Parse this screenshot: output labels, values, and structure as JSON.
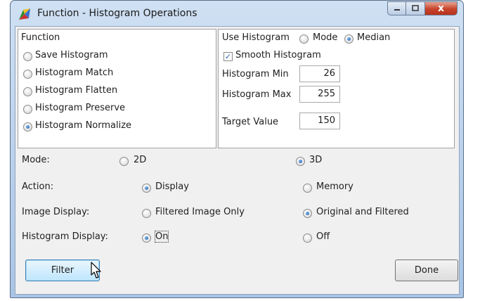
{
  "window": {
    "title": "Function - Histogram Operations",
    "close_glyph": "x"
  },
  "function_group": {
    "title": "Function",
    "options": [
      {
        "label": "Save Histogram",
        "selected": false
      },
      {
        "label": "Histogram Match",
        "selected": false
      },
      {
        "label": "Histogram Flatten",
        "selected": false
      },
      {
        "label": "Histogram Preserve",
        "selected": false
      },
      {
        "label": "Histogram Normalize",
        "selected": true
      }
    ]
  },
  "use_histogram": {
    "label": "Use Histogram",
    "options": [
      {
        "label": "Mode",
        "selected": false
      },
      {
        "label": "Median",
        "selected": true
      }
    ]
  },
  "smooth_histogram": {
    "label": "Smooth Histogram",
    "checked": true,
    "check_glyph": "✓"
  },
  "fields": [
    {
      "label": "Histogram Min",
      "value": "26"
    },
    {
      "label": "Histogram Max",
      "value": "255"
    },
    {
      "label": "Target Value",
      "value": "150"
    }
  ],
  "mode": {
    "label": "Mode:",
    "options": [
      {
        "label": "2D",
        "selected": false
      },
      {
        "label": "3D",
        "selected": true
      }
    ]
  },
  "action": {
    "label": "Action:",
    "options": [
      {
        "label": "Display",
        "selected": true
      },
      {
        "label": "Memory",
        "selected": false
      }
    ]
  },
  "image_display": {
    "label": "Image Display:",
    "options": [
      {
        "label": "Filtered Image Only",
        "selected": false
      },
      {
        "label": "Original and Filtered",
        "selected": true
      }
    ]
  },
  "histogram_display": {
    "label": "Histogram Display:",
    "options": [
      {
        "label": "On",
        "selected": true
      },
      {
        "label": "Off",
        "selected": false
      }
    ]
  },
  "buttons": {
    "filter": "Filter",
    "done": "Done"
  }
}
